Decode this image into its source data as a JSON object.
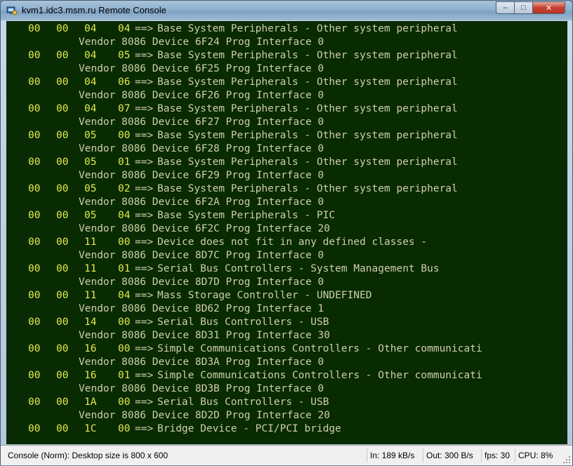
{
  "window": {
    "title": "kvm1.idc3.msm.ru Remote Console",
    "minimize_glyph": "‒",
    "maximize_glyph": "□",
    "close_glyph": "✕",
    "icons": {
      "app": "remote-console-icon",
      "resize": "resize-grip-icon"
    }
  },
  "console": {
    "arrow": "==>",
    "entries": [
      {
        "bus": "00",
        "dev": "00",
        "cls": "04",
        "sub": "04",
        "desc": "Base System Peripherals - Other system peripheral",
        "vendor": "Vendor 8086 Device 6F24 Prog Interface 0"
      },
      {
        "bus": "00",
        "dev": "00",
        "cls": "04",
        "sub": "05",
        "desc": "Base System Peripherals - Other system peripheral",
        "vendor": "Vendor 8086 Device 6F25 Prog Interface 0"
      },
      {
        "bus": "00",
        "dev": "00",
        "cls": "04",
        "sub": "06",
        "desc": "Base System Peripherals - Other system peripheral",
        "vendor": "Vendor 8086 Device 6F26 Prog Interface 0"
      },
      {
        "bus": "00",
        "dev": "00",
        "cls": "04",
        "sub": "07",
        "desc": "Base System Peripherals - Other system peripheral",
        "vendor": "Vendor 8086 Device 6F27 Prog Interface 0"
      },
      {
        "bus": "00",
        "dev": "00",
        "cls": "05",
        "sub": "00",
        "desc": "Base System Peripherals - Other system peripheral",
        "vendor": "Vendor 8086 Device 6F28 Prog Interface 0"
      },
      {
        "bus": "00",
        "dev": "00",
        "cls": "05",
        "sub": "01",
        "desc": "Base System Peripherals - Other system peripheral",
        "vendor": "Vendor 8086 Device 6F29 Prog Interface 0"
      },
      {
        "bus": "00",
        "dev": "00",
        "cls": "05",
        "sub": "02",
        "desc": "Base System Peripherals - Other system peripheral",
        "vendor": "Vendor 8086 Device 6F2A Prog Interface 0"
      },
      {
        "bus": "00",
        "dev": "00",
        "cls": "05",
        "sub": "04",
        "desc": "Base System Peripherals - PIC",
        "vendor": "Vendor 8086 Device 6F2C Prog Interface 20"
      },
      {
        "bus": "00",
        "dev": "00",
        "cls": "11",
        "sub": "00",
        "desc": "Device does not fit in any defined classes -",
        "vendor": "Vendor 8086 Device 8D7C Prog Interface 0"
      },
      {
        "bus": "00",
        "dev": "00",
        "cls": "11",
        "sub": "01",
        "desc": "Serial Bus Controllers - System Management Bus",
        "vendor": "Vendor 8086 Device 8D7D Prog Interface 0"
      },
      {
        "bus": "00",
        "dev": "00",
        "cls": "11",
        "sub": "04",
        "desc": "Mass Storage Controller - UNDEFINED",
        "vendor": "Vendor 8086 Device 8D62 Prog Interface 1"
      },
      {
        "bus": "00",
        "dev": "00",
        "cls": "14",
        "sub": "00",
        "desc": "Serial Bus Controllers - USB",
        "vendor": "Vendor 8086 Device 8D31 Prog Interface 30"
      },
      {
        "bus": "00",
        "dev": "00",
        "cls": "16",
        "sub": "00",
        "desc": "Simple Communications Controllers - Other communicati",
        "vendor": "Vendor 8086 Device 8D3A Prog Interface 0"
      },
      {
        "bus": "00",
        "dev": "00",
        "cls": "16",
        "sub": "01",
        "desc": "Simple Communications Controllers - Other communicati",
        "vendor": "Vendor 8086 Device 8D3B Prog Interface 0"
      },
      {
        "bus": "00",
        "dev": "00",
        "cls": "1A",
        "sub": "00",
        "desc": "Serial Bus Controllers - USB",
        "vendor": "Vendor 8086 Device 8D2D Prog Interface 20"
      },
      {
        "bus": "00",
        "dev": "00",
        "cls": "1C",
        "sub": "00",
        "desc": "Bridge Device - PCI/PCI bridge",
        "vendor": ""
      }
    ]
  },
  "status": {
    "mode": "Console (Norm): Desktop size is 800 x 600",
    "in_rate": "In: 189 kB/s",
    "out_rate": "Out: 300 B/s",
    "fps": "fps: 30",
    "cpu": "CPU:  8%"
  }
}
